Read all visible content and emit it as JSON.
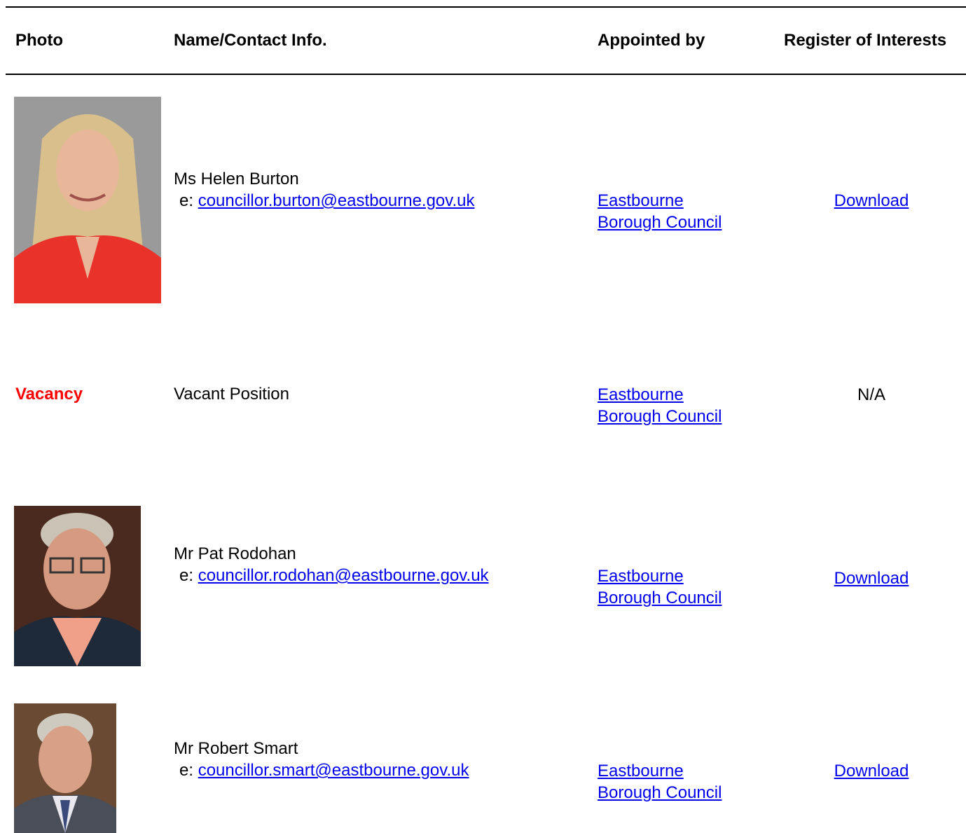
{
  "headers": {
    "photo": "Photo",
    "name": "Name/Contact Info.",
    "appointed": "Appointed by",
    "register": "Register of Interests"
  },
  "members": [
    {
      "name": "Ms Helen Burton",
      "email_prefix": "e: ",
      "email": "councillor.burton@eastbourne.gov.uk",
      "appointed_line1": "Eastbourne",
      "appointed_line2": "Borough Council",
      "register": "Download"
    },
    {
      "photo_text": "Vacancy",
      "name": "Vacant Position",
      "appointed_line1": "Eastbourne",
      "appointed_line2": "Borough Council",
      "register": "N/A"
    },
    {
      "name": "Mr Pat Rodohan",
      "email_prefix": "e: ",
      "email": "councillor.rodohan@eastbourne.gov.uk",
      "appointed_line1": "Eastbourne",
      "appointed_line2": "Borough Council",
      "register": "Download"
    },
    {
      "name": "Mr Robert Smart",
      "email_prefix": "e: ",
      "email": "councillor.smart@eastbourne.gov.uk",
      "appointed_line1": "Eastbourne",
      "appointed_line2": "Borough Council",
      "register": "Download"
    }
  ],
  "colors": {
    "link": "#0000ee",
    "vacancy": "#ff0000"
  }
}
